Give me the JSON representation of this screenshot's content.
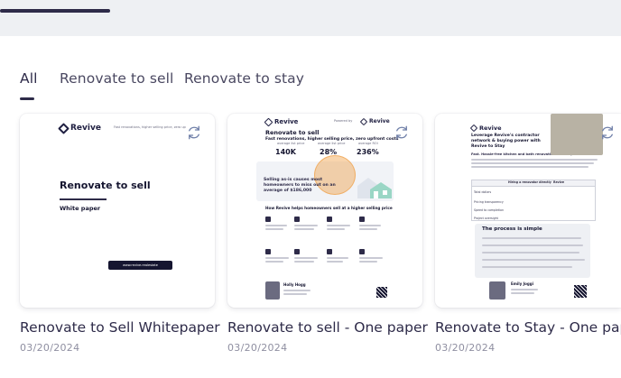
{
  "tabs": [
    {
      "label": "All",
      "active": true
    },
    {
      "label": "Renovate to sell",
      "active": false
    },
    {
      "label": "Renovate to stay",
      "active": false
    }
  ],
  "cards": [
    {
      "title": "Renovate to Sell Whitepaper",
      "date": "03/20/2024",
      "doc": {
        "brand": "Revive",
        "header_note": "Fast renovations, higher selling price, zero upfront costs",
        "heading": "Renovate to sell",
        "subheading": "White paper",
        "url_pill": "www.revive.realestate"
      }
    },
    {
      "title": "Renovate to sell - One paper",
      "date": "03/20/2024",
      "doc": {
        "brand": "Revive",
        "powered_by": "Powered by",
        "heading": "Renovate to sell",
        "subheading": "Fast renovations, higher selling price, zero upfront costs",
        "stats": [
          {
            "label": "average list price",
            "value": "140K"
          },
          {
            "label": "average list price",
            "value": "28%"
          },
          {
            "label": "average ROI",
            "value": "236%"
          }
        ],
        "callout": "Selling as-is causes most homeowners to miss out on an average of $186,000",
        "section": "How Revive helps homeowners sell at a higher selling price",
        "agent_name": "Holly Hogg"
      }
    },
    {
      "title": "Renovate to Stay - One paper",
      "date": "03/20/2024",
      "doc": {
        "brand": "Revive",
        "heading": "Leverage Revive's contractor network & buying power with Revive to Stay",
        "subheading": "Fast. Hassle-free kitchen and bath renovations at competitive prices",
        "table_headers": [
          "",
          "Hiring a renovator directly",
          "Revive"
        ],
        "table_rows": [
          "Total dollars",
          "Pricing transparency",
          "Speed to completion",
          "Project oversight"
        ],
        "process_title": "The process is simple",
        "agent_name": "Emily Joggi"
      }
    }
  ],
  "colors": {
    "navy": "#2e2b49",
    "topbar": "#eef0f3",
    "accent_orange": "#f0a14a",
    "muted_date": "#8f8fa1"
  }
}
